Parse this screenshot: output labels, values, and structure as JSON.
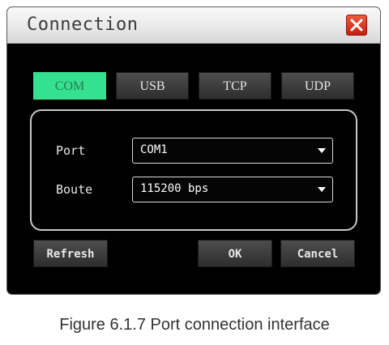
{
  "dialog": {
    "title": "Connection",
    "close_icon": "close-x-icon",
    "close_color": "#d93a1f"
  },
  "tabs": [
    {
      "label": "COM",
      "active": true
    },
    {
      "label": "USB",
      "active": false
    },
    {
      "label": "TCP",
      "active": false
    },
    {
      "label": "UDP",
      "active": false
    }
  ],
  "accent_color": "#35e08f",
  "fields": {
    "port": {
      "label": "Port",
      "value": "COM1"
    },
    "baud": {
      "label": "Boute",
      "value": "115200 bps"
    }
  },
  "buttons": {
    "refresh": "Refresh",
    "ok": "OK",
    "cancel": "Cancel"
  },
  "caption": "Figure 6.1.7 Port connection interface"
}
